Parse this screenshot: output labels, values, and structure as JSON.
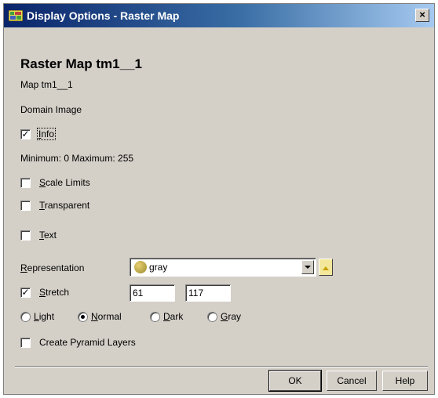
{
  "window": {
    "title": "Display Options - Raster Map",
    "close_glyph": "×"
  },
  "header": {
    "map_title": "Raster Map  tm1__1",
    "map_name": "Map tm1__1",
    "domain": "Domain Image"
  },
  "info": {
    "label_pre": "",
    "label_u": "I",
    "label_post": "nfo",
    "checked": true,
    "range_text": "Minimum: 0  Maximum: 255"
  },
  "options": {
    "scale_limits": {
      "u": "S",
      "rest": "cale Limits",
      "checked": false
    },
    "transparent": {
      "u": "T",
      "rest": "ransparent",
      "checked": false
    },
    "text": {
      "u": "T",
      "rest": "ext",
      "checked": false
    }
  },
  "representation": {
    "u": "R",
    "rest": "epresentation",
    "value": "gray",
    "icon": "palette-icon"
  },
  "stretch": {
    "u": "S",
    "rest": "tretch",
    "checked": true,
    "min": "61",
    "max": "117"
  },
  "modes": [
    {
      "u": "L",
      "rest": "ight",
      "selected": false
    },
    {
      "u": "N",
      "rest": "ormal",
      "selected": true
    },
    {
      "u": "D",
      "rest": "ark",
      "selected": false
    },
    {
      "u": "G",
      "rest": "ray",
      "selected": false
    }
  ],
  "pyramid": {
    "label": "Create Pyramid Layers",
    "checked": false
  },
  "buttons": {
    "ok": "OK",
    "cancel": "Cancel",
    "help": "Help"
  },
  "colors": {
    "title_start": "#0a246a",
    "title_end": "#a6caf0",
    "face": "#d4d0c8"
  }
}
